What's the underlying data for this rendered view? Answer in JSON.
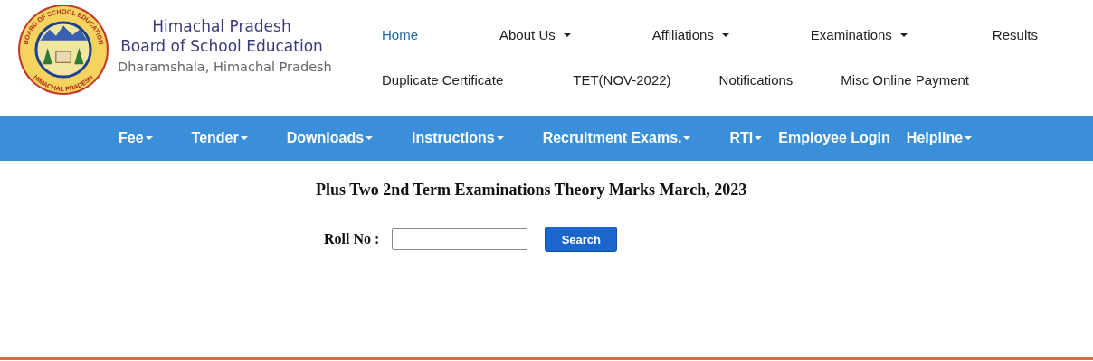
{
  "logo": {
    "top_text": "BOARD OF SCHOOL EDUCATION",
    "bottom_text": "HIMACHAL PRADESH"
  },
  "brand": {
    "title_line_1": "Himachal Pradesh",
    "title_line_2": "Board of School Education",
    "subtitle": "Dharamshala, Himachal Pradesh"
  },
  "top_nav": [
    [
      {
        "label": "Home",
        "selected": true,
        "dropdown": false
      },
      {
        "label": "About Us",
        "selected": false,
        "dropdown": true
      },
      {
        "label": "Affiliations",
        "selected": false,
        "dropdown": true
      },
      {
        "label": "Examinations",
        "selected": false,
        "dropdown": true
      },
      {
        "label": "Results",
        "selected": false,
        "dropdown": false
      }
    ],
    [
      {
        "label": "Duplicate Certificate",
        "selected": false,
        "dropdown": false
      },
      {
        "label": "TET(NOV-2022)",
        "selected": false,
        "dropdown": false
      },
      {
        "label": "Notifications",
        "selected": false,
        "dropdown": false
      },
      {
        "label": "Misc Online Payment",
        "selected": false,
        "dropdown": false
      }
    ]
  ],
  "main_nav": [
    {
      "label": "Fee",
      "dropdown": true
    },
    {
      "label": "Tender",
      "dropdown": true
    },
    {
      "label": "Downloads",
      "dropdown": true
    },
    {
      "label": "Instructions",
      "dropdown": true
    },
    {
      "label": "Recruitment Exams.",
      "dropdown": true
    },
    {
      "label": "RTI",
      "dropdown": true
    },
    {
      "label": "Employee Login",
      "dropdown": false
    },
    {
      "label": "Helpline",
      "dropdown": true
    }
  ],
  "page_title": "Plus Two 2nd Term Examinations Theory Marks March, 2023",
  "form": {
    "label": "Roll No :",
    "button": "Search"
  }
}
